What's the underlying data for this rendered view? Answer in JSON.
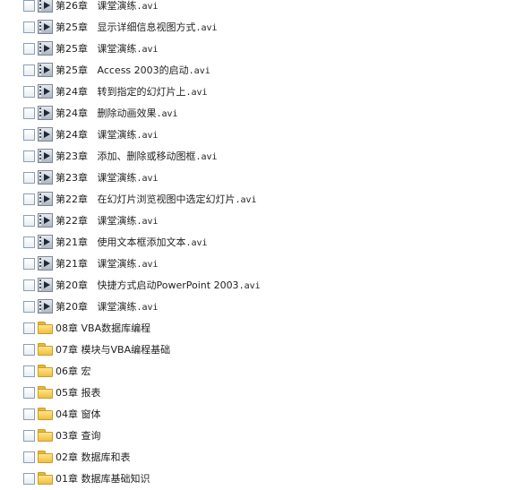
{
  "file_browser": {
    "video_icon": "video-file-icon",
    "folder_icon": "folder-icon",
    "checkbox_checked": false,
    "items": [
      {
        "type": "video",
        "chapter": "第26章",
        "title": "课堂演练",
        "ext": ".avi"
      },
      {
        "type": "video",
        "chapter": "第25章",
        "title": "显示详细信息视图方式",
        "ext": ".avi"
      },
      {
        "type": "video",
        "chapter": "第25章",
        "title": "课堂演练",
        "ext": ".avi"
      },
      {
        "type": "video",
        "chapter": "第25章",
        "title": "Access 2003的启动",
        "ext": ".avi"
      },
      {
        "type": "video",
        "chapter": "第24章",
        "title": "转到指定的幻灯片上",
        "ext": ".avi"
      },
      {
        "type": "video",
        "chapter": "第24章",
        "title": "删除动画效果",
        "ext": ".avi"
      },
      {
        "type": "video",
        "chapter": "第24章",
        "title": "课堂演练",
        "ext": ".avi"
      },
      {
        "type": "video",
        "chapter": "第23章",
        "title": "添加、删除或移动图框",
        "ext": ".avi"
      },
      {
        "type": "video",
        "chapter": "第23章",
        "title": "课堂演练",
        "ext": ".avi"
      },
      {
        "type": "video",
        "chapter": "第22章",
        "title": "在幻灯片浏览视图中选定幻灯片",
        "ext": ".avi"
      },
      {
        "type": "video",
        "chapter": "第22章",
        "title": "课堂演练",
        "ext": ".avi"
      },
      {
        "type": "video",
        "chapter": "第21章",
        "title": "使用文本框添加文本",
        "ext": ".avi"
      },
      {
        "type": "video",
        "chapter": "第21章",
        "title": "课堂演练",
        "ext": ".avi"
      },
      {
        "type": "video",
        "chapter": "第20章",
        "title": "快捷方式启动PowerPoint 2003",
        "ext": ".avi"
      },
      {
        "type": "video",
        "chapter": "第20章",
        "title": "课堂演练",
        "ext": ".avi"
      },
      {
        "type": "folder",
        "chapter": "08章",
        "title": "VBA数据库编程",
        "ext": ""
      },
      {
        "type": "folder",
        "chapter": "07章",
        "title": "模块与VBA编程基础",
        "ext": ""
      },
      {
        "type": "folder",
        "chapter": "06章",
        "title": "宏",
        "ext": ""
      },
      {
        "type": "folder",
        "chapter": "05章",
        "title": "报表",
        "ext": ""
      },
      {
        "type": "folder",
        "chapter": "04章",
        "title": "窗体",
        "ext": ""
      },
      {
        "type": "folder",
        "chapter": "03章",
        "title": "查询",
        "ext": ""
      },
      {
        "type": "folder",
        "chapter": "02章",
        "title": "数据库和表",
        "ext": ""
      },
      {
        "type": "folder",
        "chapter": "01章",
        "title": "数据库基础知识",
        "ext": ""
      }
    ]
  }
}
